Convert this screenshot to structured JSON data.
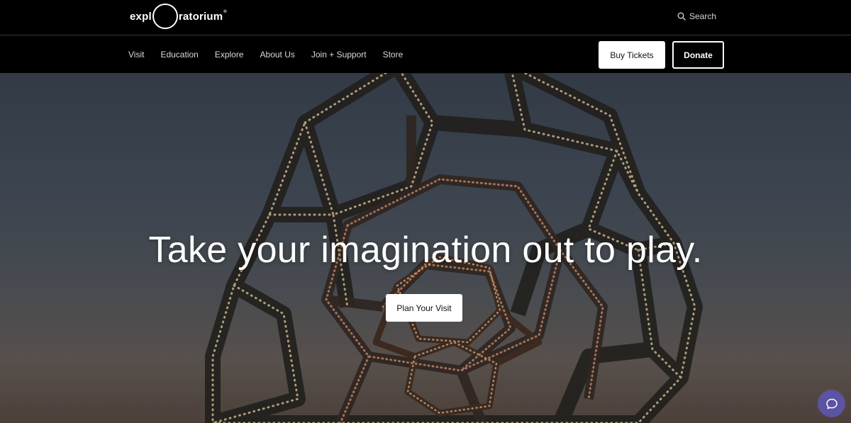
{
  "header": {
    "logo_left": "expl",
    "logo_right": "ratorium",
    "logo_tm": "®",
    "search_label": "Search"
  },
  "nav": {
    "items": [
      {
        "label": "Visit"
      },
      {
        "label": "Education"
      },
      {
        "label": "Explore"
      },
      {
        "label": "About Us"
      },
      {
        "label": "Join + Support"
      },
      {
        "label": "Store"
      }
    ],
    "buy_tickets": "Buy Tickets",
    "donate": "Donate"
  },
  "hero": {
    "title": "Take your imagination out to play.",
    "cta": "Plan Your Visit"
  },
  "colors": {
    "chat_button": "#5b53a3",
    "bar_background": "#000000"
  },
  "icons": {
    "search": "search-icon",
    "chat": "chat-icon"
  }
}
